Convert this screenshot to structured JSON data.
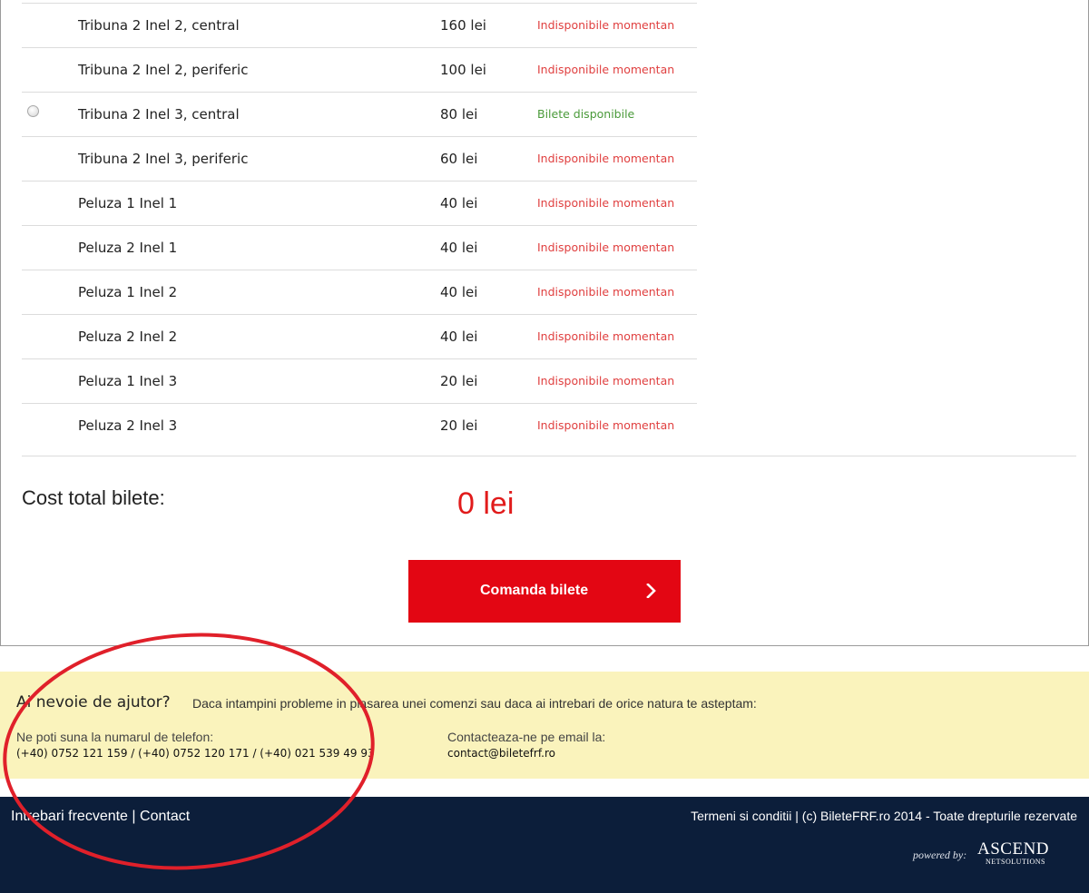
{
  "tickets": {
    "rows": [
      {
        "name": "Tribuna 2 Inel 2, central",
        "price": "160 lei",
        "status": "Indisponibile momentan",
        "available": false
      },
      {
        "name": "Tribuna 2 Inel 2, periferic",
        "price": "100 lei",
        "status": "Indisponibile momentan",
        "available": false
      },
      {
        "name": "Tribuna 2 Inel 3, central",
        "price": "80 lei",
        "status": "Bilete disponibile",
        "available": true
      },
      {
        "name": "Tribuna 2 Inel 3, periferic",
        "price": "60 lei",
        "status": "Indisponibile momentan",
        "available": false
      },
      {
        "name": "Peluza 1 Inel 1",
        "price": "40 lei",
        "status": "Indisponibile momentan",
        "available": false
      },
      {
        "name": "Peluza 2 Inel 1",
        "price": "40 lei",
        "status": "Indisponibile momentan",
        "available": false
      },
      {
        "name": "Peluza 1 Inel 2",
        "price": "40 lei",
        "status": "Indisponibile momentan",
        "available": false
      },
      {
        "name": "Peluza 2 Inel 2",
        "price": "40 lei",
        "status": "Indisponibile momentan",
        "available": false
      },
      {
        "name": "Peluza 1 Inel 3",
        "price": "20 lei",
        "status": "Indisponibile momentan",
        "available": false
      },
      {
        "name": "Peluza 2 Inel 3",
        "price": "20 lei",
        "status": "Indisponibile momentan",
        "available": false
      }
    ]
  },
  "total": {
    "label": "Cost total bilete:",
    "value": "0 lei"
  },
  "order_button": {
    "label": "Comanda bilete",
    "icon": "chevron-right-icon"
  },
  "help": {
    "title": "Ai nevoie de ajutor?",
    "description": "Daca intampini probleme in plasarea unei comenzi sau daca ai intrebari de orice natura te asteptam:",
    "phone_label": "Ne poti suna la numarul de telefon:",
    "phone_numbers": "(+40) 0752 121 159 / (+40) 0752 120 171 / (+40) 021 539 49 93",
    "email_label": "Contacteaza-ne pe email la:",
    "email": "contact@biletefrf.ro"
  },
  "footer": {
    "faq_link": "Intrebari frecvente",
    "separator": "|",
    "contact_link": "Contact",
    "copyright": "Termeni si conditii | (c) BileteFRF.ro 2014 - Toate drepturile rezervate",
    "powered_by": "powered by:",
    "logo_main": "ASCEND",
    "logo_sub": "NETSOLUTIONS"
  },
  "colors": {
    "accent_red": "#e30613",
    "unavailable_red": "#e04040",
    "available_green": "#4a9a3a",
    "help_bg": "#faf3bc",
    "footer_bg": "#0c1e3a",
    "annotation_circle": "#e0202a"
  }
}
